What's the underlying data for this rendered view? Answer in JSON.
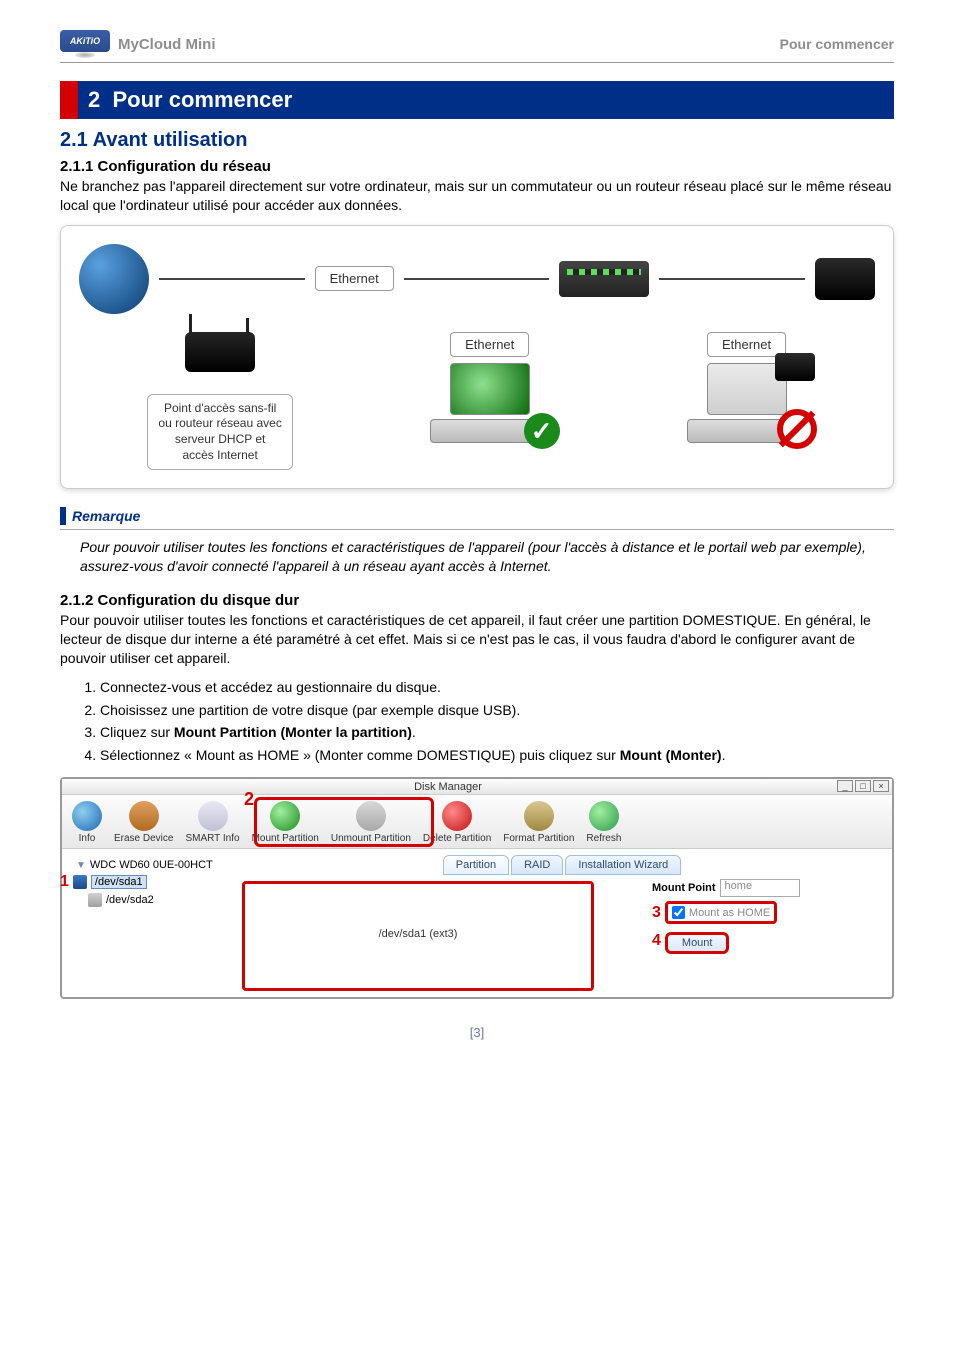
{
  "header": {
    "brand": "AKiTiO",
    "product": "MyCloud Mini",
    "page_label": "Pour commencer"
  },
  "chapter": {
    "number": "2",
    "title": "Pour commencer"
  },
  "s21": {
    "heading": "2.1  Avant utilisation",
    "s211": {
      "heading": "2.1.1   Configuration du réseau",
      "body": "Ne branchez pas l'appareil directement sur votre ordinateur, mais sur un commutateur ou un routeur réseau placé sur le même réseau local que l'ordinateur utilisé pour accéder aux données."
    },
    "diagram": {
      "ethernet": "Ethernet",
      "router_caption_l1": "Point d'accès sans-fil",
      "router_caption_l2": "ou routeur réseau avec",
      "router_caption_l3": "serveur DHCP et",
      "router_caption_l4": "accès Internet"
    },
    "note": {
      "title": "Remarque",
      "body": "Pour pouvoir utiliser toutes les fonctions et caractéristiques de l'appareil (pour l'accès à distance et le portail web par exemple), assurez-vous d'avoir connecté l'appareil à un réseau ayant accès à Internet."
    },
    "s212": {
      "heading": "2.1.2   Configuration du disque dur",
      "body": "Pour pouvoir utiliser toutes les fonctions et caractéristiques de cet appareil, il faut créer une partition DOMESTIQUE. En général, le lecteur de disque dur interne a été paramétré à cet effet. Mais si ce n'est pas le cas, il vous faudra d'abord le configurer avant de pouvoir utiliser cet appareil.",
      "steps": [
        "Connectez-vous et accédez au gestionnaire du disque.",
        "Choisissez une partition de votre disque (par exemple disque USB).",
        "Cliquez sur <b>Mount Partition (Monter la partition)</b>.",
        "Sélectionnez « Mount as HOME » (Monter comme DOMESTIQUE) puis cliquez sur <b>Mount (Monter)</b>."
      ]
    }
  },
  "disk_manager": {
    "title": "Disk Manager",
    "toolbar": [
      "Info",
      "Erase Device",
      "SMART Info",
      "Mount Partition",
      "Unmount Partition",
      "Delete Partition",
      "Format Partition",
      "Refresh"
    ],
    "tabs": [
      "Partition",
      "RAID",
      "Installation Wizard"
    ],
    "tree": {
      "disk": "WDC WD60 0UE-00HCT",
      "part1": "/dev/sda1",
      "part2": "/dev/sda2"
    },
    "partition_label": "/dev/sda1 (ext3)",
    "mount_point_label": "Mount Point",
    "mount_point_value": "home",
    "mount_as_home": "Mount as HOME",
    "mount_btn": "Mount",
    "callouts": {
      "n1": "1",
      "n2": "2",
      "n3": "3",
      "n4": "4"
    }
  },
  "footer": {
    "page": "[3]"
  }
}
